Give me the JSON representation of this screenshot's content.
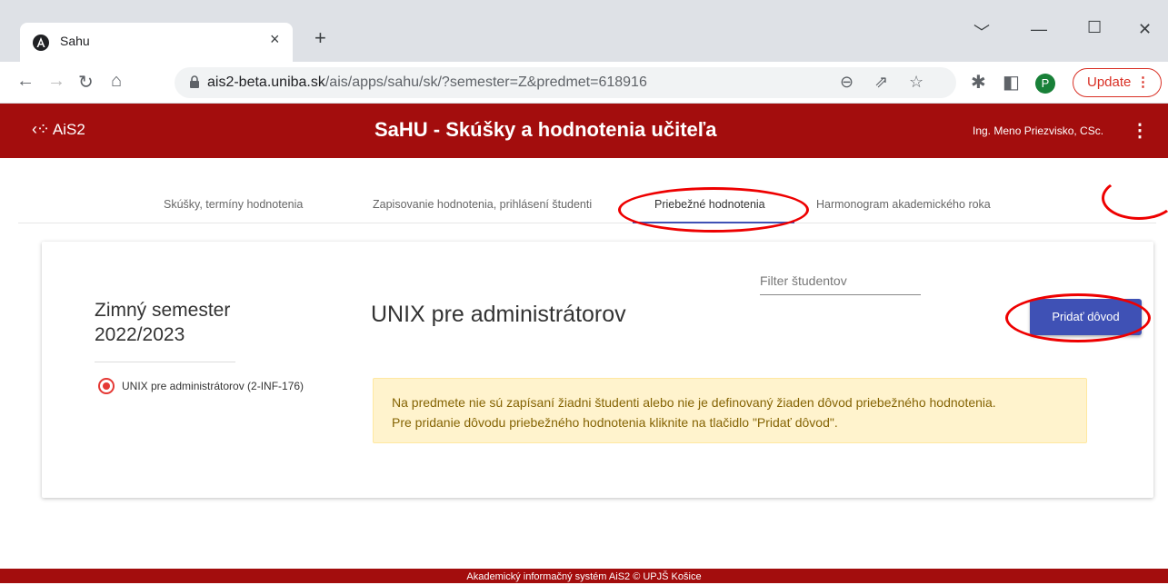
{
  "browser": {
    "tab_title": "Sahu",
    "tab_close": "×",
    "new_tab": "+",
    "url_domain": "ais2-beta.uniba.sk",
    "url_path": "/ais/apps/sahu/sk/?semester=Z&predmet=618916",
    "profile_initial": "P",
    "update_label": "Update"
  },
  "app": {
    "logo_text": "AiS2",
    "title": "SaHU - Skúšky a hodnotenia učiteľa",
    "user": "Ing. Meno Priezvisko, CSc."
  },
  "nav": {
    "tabs": [
      "Skúšky, termíny hodnotenia",
      "Zapisovanie hodnotenia, prihlásení študenti",
      "Priebežné hodnotenia",
      "Harmonogram akademického roka"
    ]
  },
  "main": {
    "semester_line1": "Zimný semester",
    "semester_line2": "2022/2023",
    "course_item": "UNIX pre administrátorov (2-INF-176)",
    "course_title": "UNIX pre administrátorov",
    "filter_placeholder": "Filter študentov",
    "add_button": "Pridať dôvod",
    "alert_line1": "Na predmete nie sú zapísaní žiadni študenti alebo nie je definovaný žiaden dôvod priebežného hodnotenia.",
    "alert_line2": "Pre pridanie dôvodu priebežného hodnotenia kliknite na tlačidlo \"Pridať dôvod\"."
  },
  "footer": "Akademický informačný systém AiS2 © UPJŠ Košice"
}
